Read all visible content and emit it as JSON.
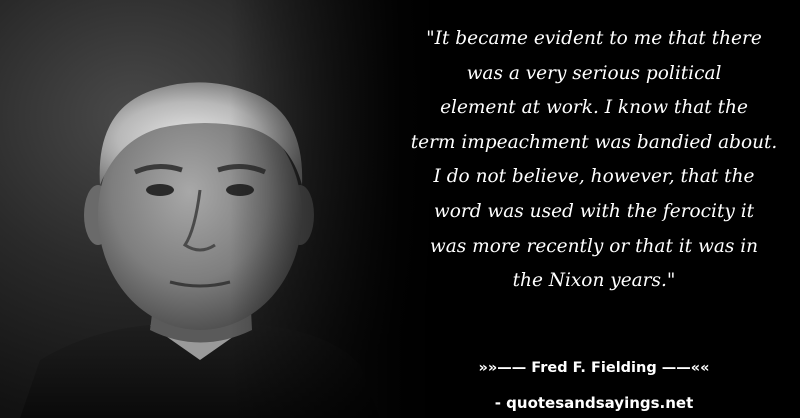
{
  "quote": {
    "lines": [
      "\"It became evident to me that there",
      "was a very serious political",
      "element at work. I know that the",
      "term impeachment was bandied about.",
      "I do not believe, however, that the",
      "word was used with the ferocity it",
      "was more recently or that it was in",
      "the Nixon years.\""
    ]
  },
  "attribution": {
    "author": "»»—— Fred F. Fielding ——««"
  },
  "website": {
    "label": "- quotesandsayings.net"
  }
}
